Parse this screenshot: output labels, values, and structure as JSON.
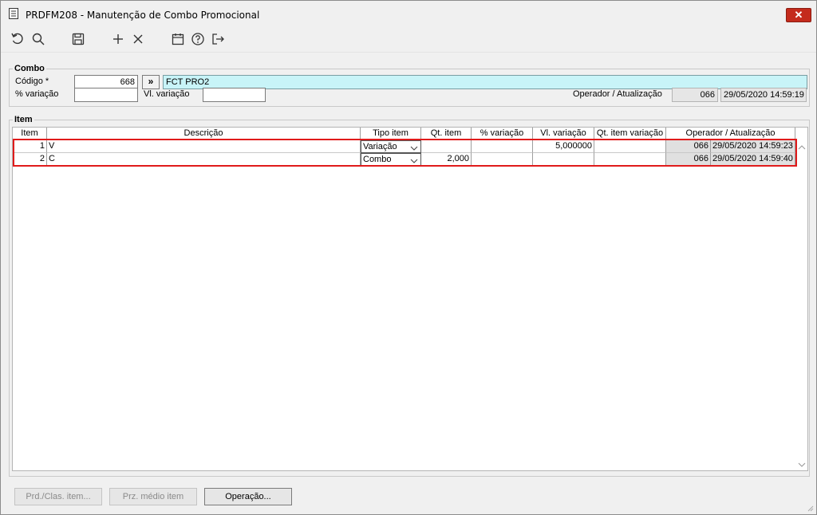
{
  "window": {
    "title": "PRDFM208 - Manutenção de Combo Promocional",
    "close_label": "✕"
  },
  "toolbar": {
    "icons": [
      "undo-icon",
      "search-icon",
      "save-icon",
      "add-icon",
      "delete-icon",
      "calendar-icon",
      "help-icon",
      "exit-icon"
    ]
  },
  "combo": {
    "legend": "Combo",
    "codigo_label": "Código *",
    "codigo_value": "668",
    "lookup_label": "»",
    "descricao_value": "FCT PRO2",
    "perc_label": "% variação",
    "perc_value": "",
    "vl_label": "Vl. variação",
    "vl_value": "",
    "operador_label": "Operador / Atualização",
    "operador_value": "066",
    "atualizacao_value": "29/05/2020 14:59:19"
  },
  "item": {
    "legend": "Item",
    "columns": [
      "Item",
      "Descrição",
      "Tipo item",
      "Qt. item",
      "% variação",
      "Vl. variação",
      "Qt. item variação",
      "Operador / Atualização"
    ],
    "rows": [
      {
        "item": "1",
        "descricao": "V",
        "tipo": "Variação",
        "qt": "",
        "perc": "",
        "vl": "5,000000",
        "qtvar": "",
        "operador": "066",
        "data": "29/05/2020 14:59:23"
      },
      {
        "item": "2",
        "descricao": "C",
        "tipo": "Combo",
        "qt": "2,000",
        "perc": "",
        "vl": "",
        "qtvar": "",
        "operador": "066",
        "data": "29/05/2020 14:59:40"
      }
    ]
  },
  "buttons": {
    "prd_clas": "Prd./Clas. item...",
    "prz_medio": "Prz. médio item",
    "operacao": "Operação..."
  },
  "colors": {
    "highlight": "#e01b1b",
    "description_field": "#c8f4f8",
    "close_button": "#c42b1c"
  }
}
